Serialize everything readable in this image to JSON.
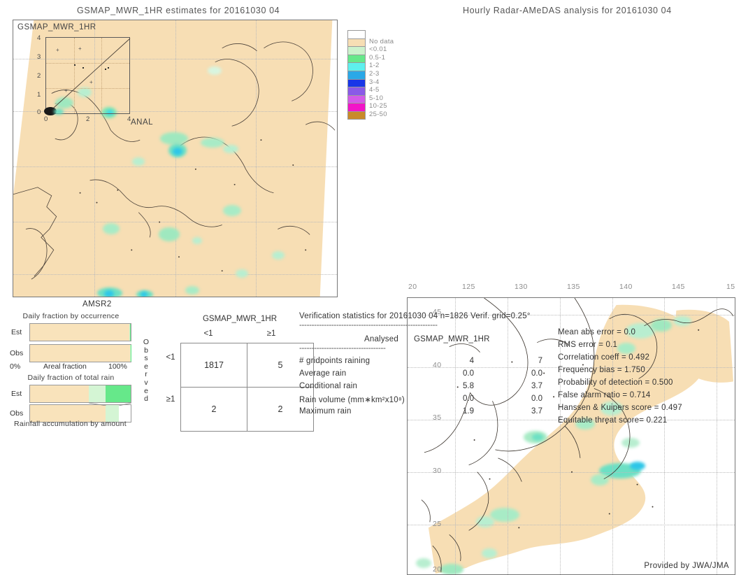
{
  "left_panel": {
    "title": "GSMAP_MWR_1HR estimates for 20161030 04",
    "overlay_label": "GSMAP_MWR_1HR",
    "anal_label": "ANAL",
    "bottom_label": "AMSR2",
    "inset_axis_ticks": [
      "0",
      "1",
      "2",
      "3",
      "4"
    ],
    "inset_x_ticks": [
      "0",
      "2",
      "4"
    ]
  },
  "right_panel": {
    "title": "Hourly Radar-AMeDAS analysis for 20161030 04",
    "credit": "Provided by JWA/JMA",
    "x_ticks": [
      "20",
      "125",
      "130",
      "135",
      "140",
      "145",
      "15"
    ],
    "y_ticks": [
      "45",
      "40",
      "35",
      "30",
      "25",
      "20"
    ]
  },
  "colorbar": {
    "entries": [
      {
        "label": "",
        "color": "#ffffff"
      },
      {
        "label": "No data",
        "color": "#f7deb4"
      },
      {
        "label": "<0.01",
        "color": "#ccf2cc"
      },
      {
        "label": "0.5-1",
        "color": "#66e88a"
      },
      {
        "label": "1-2",
        "color": "#5ef0ee"
      },
      {
        "label": "2-3",
        "color": "#2aa8e8"
      },
      {
        "label": "3-4",
        "color": "#1836e8"
      },
      {
        "label": "4-5",
        "color": "#8a5ae8"
      },
      {
        "label": "5-10",
        "color": "#d45ae8"
      },
      {
        "label": "10-25",
        "color": "#f215c8"
      },
      {
        "label": "25-50",
        "color": "#c98a2a"
      }
    ]
  },
  "bar_charts": [
    {
      "title": "Daily fraction by occurrence",
      "rows": [
        {
          "label": "Est",
          "segments": [
            {
              "color": "#f9e3bb",
              "pct": 98.5
            },
            {
              "color": "#ccf2cc",
              "pct": 1.0
            },
            {
              "color": "#66e88a",
              "pct": 0.5
            }
          ]
        },
        {
          "label": "Obs",
          "segments": [
            {
              "color": "#f9e3bb",
              "pct": 99.3
            },
            {
              "color": "#ccf2cc",
              "pct": 0.5
            },
            {
              "color": "#66e88a",
              "pct": 0.2
            }
          ]
        }
      ],
      "x_left": "0%",
      "x_center": "Areal fraction",
      "x_right": "100%"
    },
    {
      "title": "Daily fraction of total rain",
      "rows": [
        {
          "label": "Est",
          "segments": [
            {
              "color": "#f9e3bb",
              "pct": 58
            },
            {
              "color": "#d4f5d4",
              "pct": 17
            },
            {
              "color": "#66e88a",
              "pct": 25
            }
          ]
        },
        {
          "label": "Obs",
          "segments": [
            {
              "color": "#f9e3bb",
              "pct": 75
            },
            {
              "color": "#d4f5d4",
              "pct": 13
            }
          ]
        }
      ],
      "caption": "Rainfall accumulation by amount"
    }
  ],
  "contingency": {
    "header": "GSMAP_MWR_1HR",
    "col_headers": [
      "<1",
      "≥1"
    ],
    "row_headers": [
      "<1",
      "≥1"
    ],
    "side_label": "Observed",
    "cells": [
      [
        "1817",
        "5"
      ],
      [
        "2",
        "2"
      ]
    ]
  },
  "verification": {
    "header": "Verification statistics for 20161030 04   n=1826   Verif. grid=0.25°",
    "rule": "--------------------------------------------------------",
    "col_headers": [
      "Analysed",
      "GSMAP_MWR_1HR"
    ],
    "subrule": "-----------------------------------",
    "rows": [
      {
        "label": "# gridpoints raining",
        "analysed": "4",
        "estimate": "7"
      },
      {
        "label": "Average rain",
        "analysed": "0.0",
        "estimate": "0.0"
      },
      {
        "label": "Conditional rain",
        "analysed": "5.8",
        "estimate": "3.7"
      },
      {
        "label": "Rain volume (mm∗km²x10⁸)",
        "analysed": "0.0",
        "estimate": "0.0"
      },
      {
        "label": "Maximum rain",
        "analysed": "1.9",
        "estimate": "3.7"
      }
    ]
  },
  "scores": [
    "Mean abs error = 0.0",
    "RMS error = 0.1",
    "Correlation coeff = 0.492",
    "Frequency bias = 1.750",
    "Probability of detection = 0.500",
    "False alarm ratio = 0.714",
    "Hanssen & Kuipers score = 0.497",
    "Equitable threat score= 0.221"
  ]
}
